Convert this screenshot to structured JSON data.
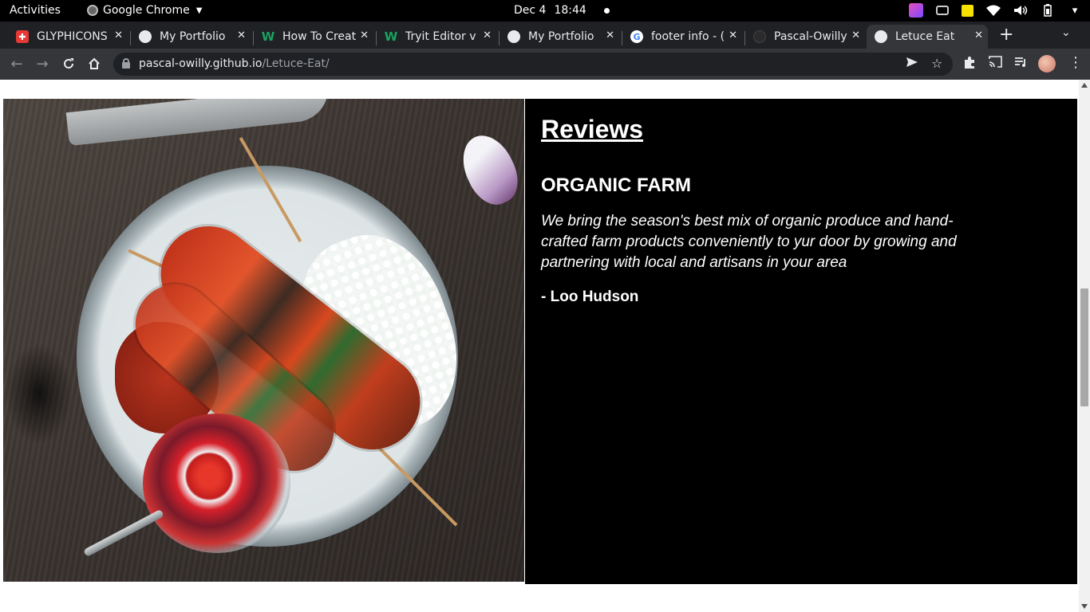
{
  "system": {
    "activities": "Activities",
    "app_name": "Google Chrome",
    "date": "Dec 4",
    "time": "18:44"
  },
  "browser": {
    "tabs": [
      {
        "label": "GLYPHICONS",
        "icon": "glyphicons-icon"
      },
      {
        "label": "My Portfolio",
        "icon": "globe-icon"
      },
      {
        "label": "How To Creat",
        "icon": "w3schools-icon"
      },
      {
        "label": "Tryit Editor v",
        "icon": "w3schools-icon"
      },
      {
        "label": "My Portfolio",
        "icon": "globe-icon"
      },
      {
        "label": "footer info - (",
        "icon": "google-icon"
      },
      {
        "label": "Pascal-Owilly",
        "icon": "github-icon"
      },
      {
        "label": "Letuce Eat",
        "icon": "globe-icon",
        "active": true
      }
    ],
    "url_host": "pascal-owilly.github.io",
    "url_path": "/Letuce-Eat/"
  },
  "page": {
    "reviews": {
      "heading": "Reviews",
      "subheading": "ORGANIC FARM",
      "quote": "We bring the season's best mix of organic produce and hand-crafted farm products conveniently to yur door by growing and partnering with local and artisans in your area",
      "author": "- Loo Hudson"
    },
    "image_alt": "grilled vegetable and meat skewers with rice and salsa"
  },
  "colors": {
    "topbar": "#000000",
    "tabstrip": "#202124",
    "toolbar": "#35363a",
    "reviews_bg": "#000000",
    "reviews_text": "#ffffff"
  }
}
